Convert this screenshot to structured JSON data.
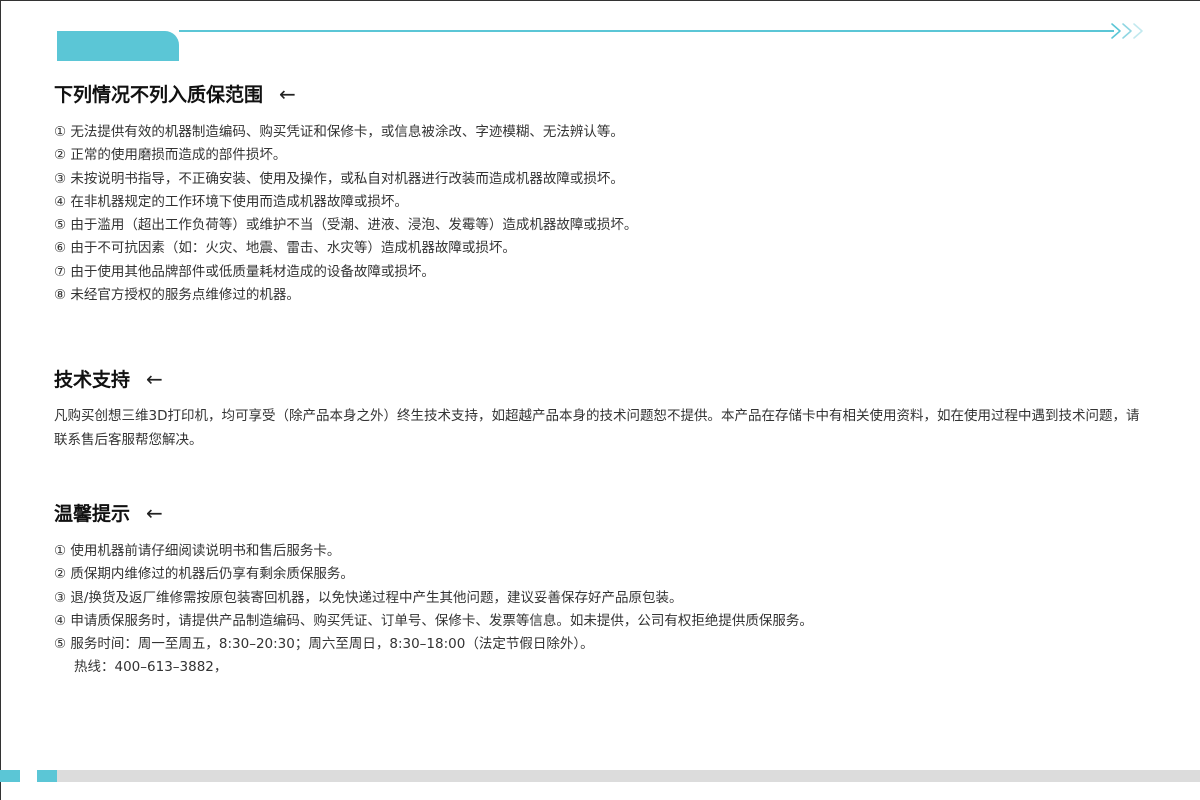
{
  "sections": {
    "warranty_exclusions": {
      "title": "下列情况不列入质保范围",
      "arrow": "←",
      "items": [
        "① 无法提供有效的机器制造编码、购买凭证和保修卡，或信息被涂改、字迹模糊、无法辨认等。",
        "② 正常的使用磨损而造成的部件损坏。",
        "③ 未按说明书指导，不正确安装、使用及操作，或私自对机器进行改装而造成机器故障或损坏。",
        "④ 在非机器规定的工作环境下使用而造成机器故障或损坏。",
        "⑤ 由于滥用（超出工作负荷等）或维护不当（受潮、进液、浸泡、发霉等）造成机器故障或损坏。",
        "⑥ 由于不可抗因素（如：火灾、地震、雷击、水灾等）造成机器故障或损坏。",
        "⑦ 由于使用其他品牌部件或低质量耗材造成的设备故障或损坏。",
        "⑧ 未经官方授权的服务点维修过的机器。"
      ]
    },
    "tech_support": {
      "title": "技术支持",
      "arrow": "←",
      "text": "凡购买创想三维3D打印机，均可享受（除产品本身之外）终生技术支持，如超越产品本身的技术问题恕不提供。本产品在存储卡中有相关使用资料，如在使用过程中遇到技术问题，请联系售后客服帮您解决。"
    },
    "tips": {
      "title": "温馨提示",
      "arrow": "←",
      "items": [
        "① 使用机器前请仔细阅读说明书和售后服务卡。",
        "② 质保期内维修过的机器后仍享有剩余质保服务。",
        "③ 退/换货及返厂维修需按原包装寄回机器，以免快递过程中产生其他问题，建议妥善保存好产品原包装。",
        "④ 申请质保服务时，请提供产品制造编码、购买凭证、订单号、保修卡、发票等信息。如未提供，公司有权拒绝提供质保服务。",
        "⑤ 服务时间：周一至周五，8:30–20:30；周六至周日，8:30–18:00（法定节假日除外）。"
      ],
      "hotline": "热线：400–613–3882，"
    }
  },
  "colors": {
    "accent": "#5bc6d6",
    "footer_gray": "#dcdcdc",
    "text": "#333333"
  },
  "icons": {
    "header_chevrons": "triple-chevron-right-icon",
    "section_arrow": "left-arrow-icon"
  }
}
